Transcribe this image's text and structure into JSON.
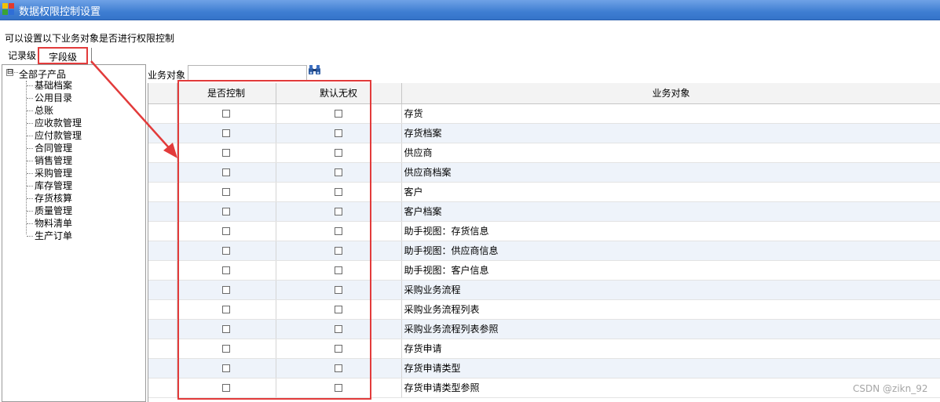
{
  "window": {
    "title": "数据权限控制设置"
  },
  "notice": "可以设置以下业务对象是否进行权限控制",
  "tabs": {
    "record": "记录级",
    "field": "字段级"
  },
  "tree": {
    "root": "全部子产品",
    "toggle": "⊟",
    "items": [
      "基础档案",
      "公用目录",
      "总账",
      "应收款管理",
      "应付款管理",
      "合同管理",
      "销售管理",
      "采购管理",
      "库存管理",
      "存货核算",
      "质量管理",
      "物料清单",
      "生产订单"
    ]
  },
  "search": {
    "label": "业务对象",
    "value": ""
  },
  "grid": {
    "columns": {
      "control": "是否控制",
      "no_permission": "默认无权",
      "object": "业务对象"
    },
    "rows": [
      {
        "name": "存货",
        "control": false,
        "no_permission": false
      },
      {
        "name": "存货档案",
        "control": false,
        "no_permission": false
      },
      {
        "name": "供应商",
        "control": false,
        "no_permission": false
      },
      {
        "name": "供应商档案",
        "control": false,
        "no_permission": false
      },
      {
        "name": "客户",
        "control": false,
        "no_permission": false
      },
      {
        "name": "客户档案",
        "control": false,
        "no_permission": false
      },
      {
        "name": "助手视图：存货信息",
        "control": false,
        "no_permission": false
      },
      {
        "name": "助手视图：供应商信息",
        "control": false,
        "no_permission": false
      },
      {
        "name": "助手视图：客户信息",
        "control": false,
        "no_permission": false
      },
      {
        "name": "采购业务流程",
        "control": false,
        "no_permission": false
      },
      {
        "name": "采购业务流程列表",
        "control": false,
        "no_permission": false
      },
      {
        "name": "采购业务流程列表参照",
        "control": false,
        "no_permission": false
      },
      {
        "name": "存货申请",
        "control": false,
        "no_permission": false
      },
      {
        "name": "存货申请类型",
        "control": false,
        "no_permission": false
      },
      {
        "name": "存货申请类型参照",
        "control": false,
        "no_permission": false
      }
    ]
  },
  "annotation_color": "#e23b3b",
  "watermark": "CSDN @zikn_92"
}
